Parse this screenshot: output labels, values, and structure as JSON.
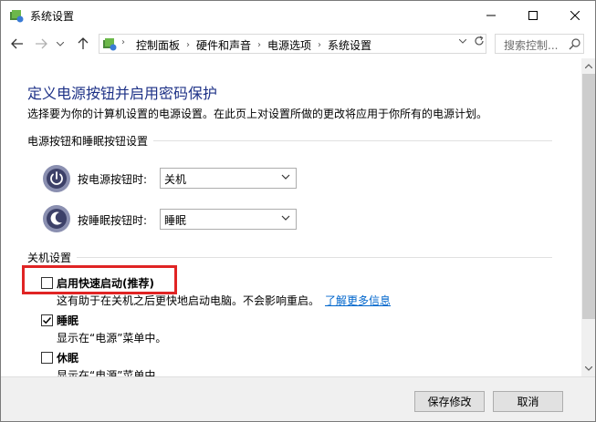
{
  "window": {
    "title": "系统设置"
  },
  "nav": {
    "breadcrumbs": [
      "控制面板",
      "硬件和声音",
      "电源选项",
      "系统设置"
    ],
    "search_placeholder": "搜索控制..."
  },
  "main": {
    "title": "定义电源按钮并启用密码保护",
    "description": "选择要为你的计算机设置的电源设置。在此页上对设置所做的更改将应用于你所有的电源计划。",
    "buttons_section": {
      "title": "电源按钮和睡眠按钮设置",
      "power_button": {
        "label": "按电源按钮时:",
        "value": "关机"
      },
      "sleep_button": {
        "label": "按睡眠按钮时:",
        "value": "睡眠"
      }
    },
    "shutdown_section": {
      "title": "关机设置",
      "options": [
        {
          "label": "启用快速启动(推荐)",
          "checked": false,
          "description": "这有助于在关机之后更快地启动电脑。不会影响重启。",
          "link": "了解更多信息"
        },
        {
          "label": "睡眠",
          "checked": true,
          "description": "显示在“电源”菜单中。"
        },
        {
          "label": "休眠",
          "checked": false,
          "description": "显示在“电源”菜单中。"
        }
      ]
    }
  },
  "footer": {
    "save_label": "保存修改",
    "cancel_label": "取消"
  },
  "colors": {
    "title_blue": "#1e3287",
    "link_blue": "#0066cc",
    "highlight_red": "#e02424"
  }
}
